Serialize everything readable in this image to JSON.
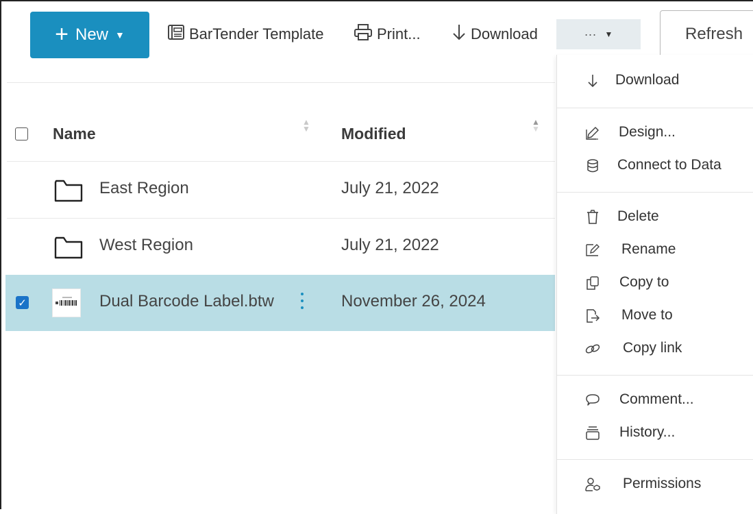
{
  "toolbar": {
    "new_label": "New",
    "bartender_label": "BarTender Template",
    "print_label": "Print...",
    "download_label": "Download",
    "more_label": "···",
    "refresh_label": "Refresh"
  },
  "table": {
    "columns": {
      "name": "Name",
      "modified": "Modified"
    },
    "rows": [
      {
        "name": "East Region",
        "modified": "July 21, 2022",
        "type": "folder",
        "selected": false
      },
      {
        "name": "West Region",
        "modified": "July 21, 2022",
        "type": "folder",
        "selected": false
      },
      {
        "name": "Dual Barcode Label.btw",
        "modified": "November 26, 2024",
        "type": "file",
        "selected": true
      }
    ]
  },
  "menu": {
    "items": [
      {
        "label": "Download",
        "icon": "arrow-down-icon"
      },
      {
        "label": "Design...",
        "icon": "pencil-icon"
      },
      {
        "label": "Connect to Data",
        "icon": "database-icon"
      },
      {
        "label": "Delete",
        "icon": "trash-icon"
      },
      {
        "label": "Rename",
        "icon": "rename-icon"
      },
      {
        "label": "Copy to",
        "icon": "copy-icon"
      },
      {
        "label": "Move to",
        "icon": "move-icon"
      },
      {
        "label": "Copy link",
        "icon": "link-icon"
      },
      {
        "label": "Comment...",
        "icon": "comment-icon"
      },
      {
        "label": "History...",
        "icon": "history-icon"
      },
      {
        "label": "Permissions",
        "icon": "permissions-icon"
      }
    ]
  },
  "colors": {
    "accent": "#1a8fbf",
    "selected_row": "#b9dde5",
    "checkbox": "#1a73c8"
  }
}
